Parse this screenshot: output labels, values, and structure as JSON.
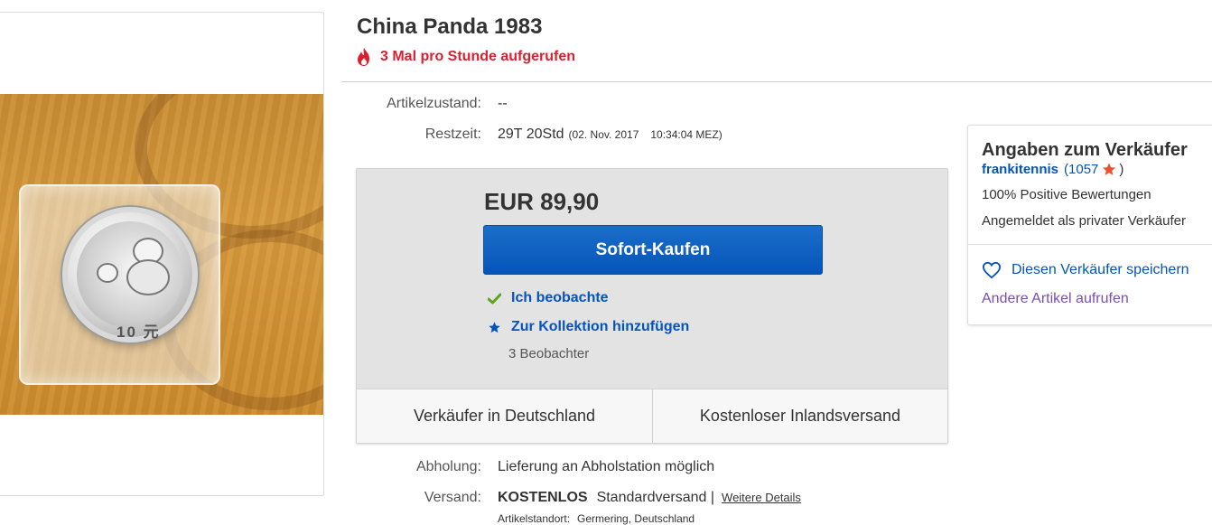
{
  "listing": {
    "title": "China Panda 1983",
    "trending_text": "3 Mal pro Stunde aufgerufen",
    "image_alt": "Silbermünze China Panda 1983 in Folie"
  },
  "details": {
    "condition_label": "Artikelzustand:",
    "condition_value": "--",
    "time_label": "Restzeit:",
    "time_value": "29T 20Std",
    "time_date": "(02. Nov. 2017",
    "time_clock": "10:34:04 MEZ)"
  },
  "buy_box": {
    "price": "EUR 89,90",
    "buy_now_label": "Sofort-Kaufen",
    "watching_label": "Ich beobachte",
    "add_collection_label": "Zur Kollektion hinzufügen",
    "watchers_count": "3 Beobachter",
    "seller_location": "Verkäufer in Deutschland",
    "shipping_note": "Kostenloser Inlandsversand"
  },
  "shipping": {
    "pickup_label": "Abholung:",
    "pickup_value": "Lieferung an Abholstation möglich",
    "shipping_label": "Versand:",
    "shipping_free": "KOSTENLOS",
    "shipping_method": "Standardversand |",
    "more_details": "Weitere Details",
    "location_label": "Artikelstandort:",
    "location_value": "Germering, Deutschland"
  },
  "seller": {
    "heading": "Angaben zum Verkäufer",
    "name": "frankitennis",
    "feedback_open": "(",
    "feedback_score": "1057",
    "feedback_close": ")",
    "positive": "100% Positive Bewertungen",
    "registered": "Angemeldet als privater Verkäufer",
    "save_seller": "Diesen Verkäufer speichern",
    "other_items": "Andere Artikel aufrufen"
  },
  "colors": {
    "accent_blue": "#0654ba",
    "trending_red": "#dd1e31",
    "star_orange": "#e8542f",
    "visited_link": "#7a4fb0",
    "check_green": "#5ba71b"
  },
  "icons": {
    "trending": "fire-icon",
    "watching": "check-icon",
    "collection": "star-icon",
    "feedback": "star-icon",
    "save_seller": "heart-icon"
  }
}
